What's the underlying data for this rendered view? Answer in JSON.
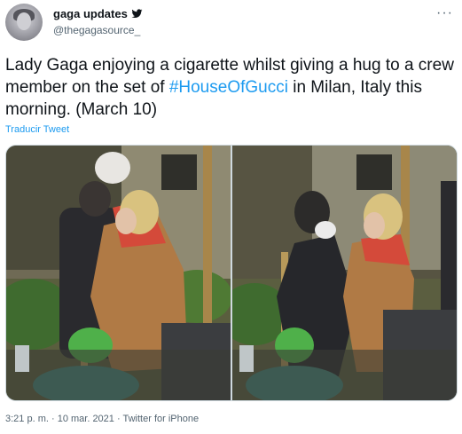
{
  "author": {
    "display_name": "gaga updates",
    "handle": "@thegagasource_",
    "verified_icon": "twitter-bird-icon",
    "avatar_icon": "avatar-portrait"
  },
  "menu": {
    "more_icon": "more-horizontal-icon",
    "more_label": "···"
  },
  "tweet": {
    "text_before": "Lady Gaga enjoying a cigarette whilst giving a hug to a crew member on the set of ",
    "hashtag": "#HouseOfGucci",
    "text_after": " in Milan, Italy this morning. (March 10)"
  },
  "translate_label": "Traducir Tweet",
  "media": {
    "count": 2,
    "photos": [
      "photo-1",
      "photo-2"
    ]
  },
  "footer": {
    "time": "3:21 p. m.",
    "separator": " · ",
    "date": "10 mar. 2021",
    "source": "Twitter for iPhone"
  },
  "colors": {
    "accent": "#1d9bf0",
    "text": "#0f1419",
    "muted": "#536471",
    "border": "#cfd9de"
  }
}
